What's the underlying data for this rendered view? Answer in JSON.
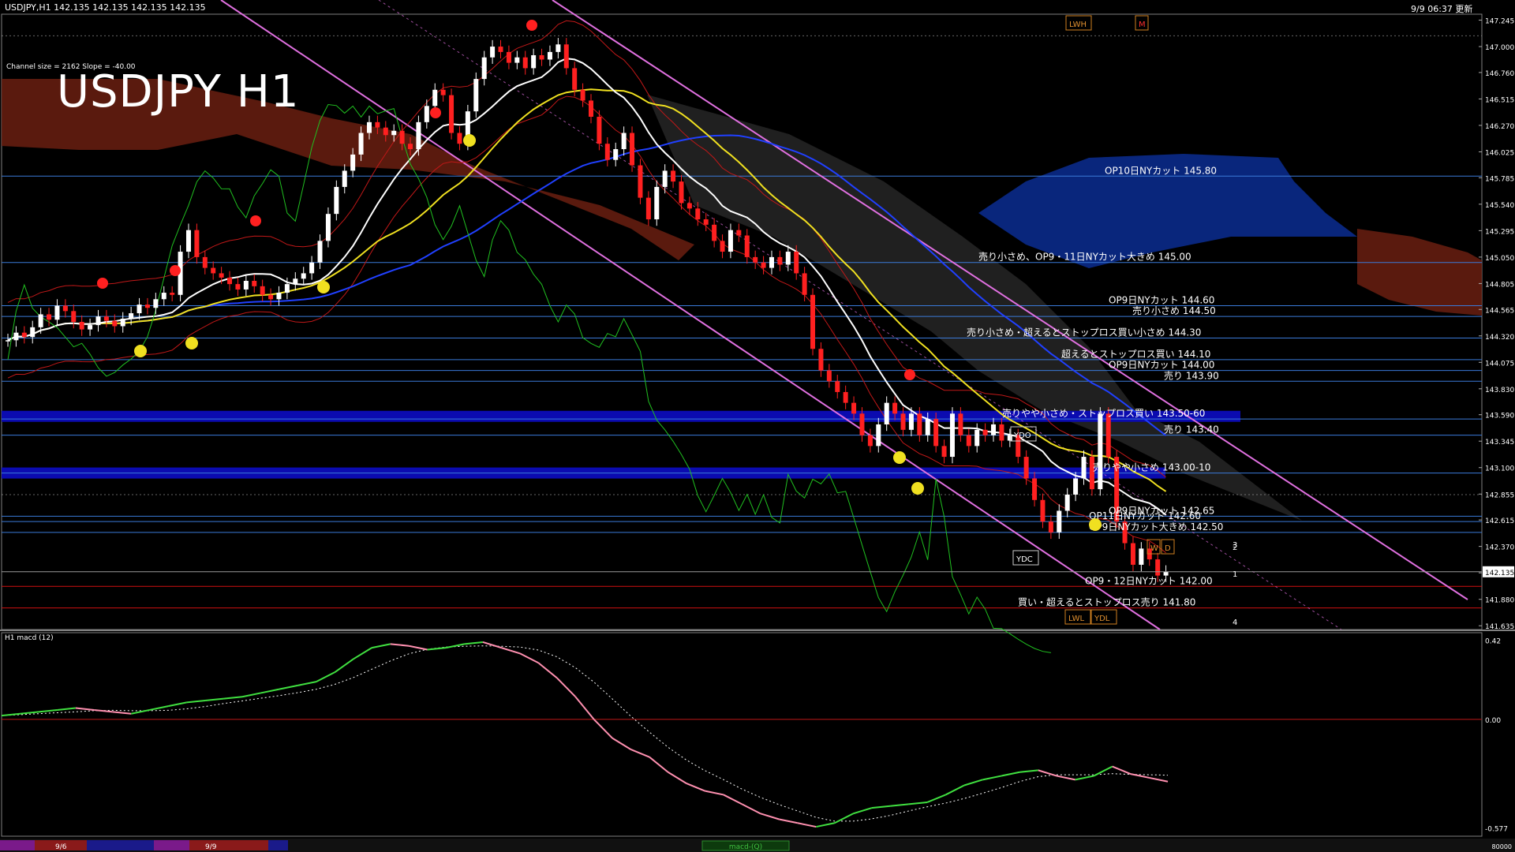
{
  "header": {
    "symbol_info": "USDJPY,H1  142.135 142.135 142.135 142.135",
    "datetime": "9/9 06:37 更新",
    "channel_info": "Channel size = 2162 Slope = -40.00",
    "big_title": "USDJPY H1"
  },
  "price_axis": {
    "labels": [
      "147.245",
      "147.000",
      "146.760",
      "146.515",
      "146.270",
      "146.025",
      "145.785",
      "145.540",
      "145.295",
      "145.050",
      "144.805",
      "144.565",
      "144.320",
      "144.075",
      "143.830",
      "143.590",
      "143.345",
      "143.100",
      "142.855",
      "142.615",
      "142.370",
      "142.125",
      "141.880",
      "141.635"
    ],
    "current_price": "142.135"
  },
  "macd_panel": {
    "title": "H1  macd (12)",
    "labels": [
      "0.42",
      "0.00",
      "-0.577"
    ]
  },
  "bottom_bar": {
    "dates": [
      "9/6",
      "9/9"
    ],
    "indicator_label": "macd-(Q)",
    "right_value": "80000"
  },
  "levels": [
    {
      "text": "OP10日NYカット 145.80",
      "color": "#ffffff"
    },
    {
      "text": "売り小さめ、OP9・11日NYカット大きめ 145.00",
      "color": "#ffffff"
    },
    {
      "text": "OP9日NYカット 144.60",
      "color": "#ffffff"
    },
    {
      "text": "売り小さめ 144.50",
      "color": "#ffffff"
    },
    {
      "text": "売り小さめ・超えるとストップロス買い小さめ 144.30",
      "color": "#ffffff"
    },
    {
      "text": "超えるとストップロス買い 144.10",
      "color": "#ffffff"
    },
    {
      "text": "OP9日NYカット 144.00",
      "color": "#ffffff"
    },
    {
      "text": "売り 143.90",
      "color": "#ffffff"
    },
    {
      "text": "売りやや小さめ・ストップロス買い 143.50-60",
      "color": "#ffffff"
    },
    {
      "text": "売り 143.40",
      "color": "#ffffff"
    },
    {
      "text": "売りやや小さめ 143.00-10",
      "color": "#ffffff"
    },
    {
      "text": "OP9日NYカット 142.65",
      "color": "#ffffff"
    },
    {
      "text": "OP11日NYカット 142.60",
      "color": "#ffffff"
    },
    {
      "text": "OP9日NYカット大きめ 142.50",
      "color": "#ffffff"
    },
    {
      "text": "OP9・12日NYカット 142.00",
      "color": "#ffffff"
    },
    {
      "text": "買い・超えるとストップロス売り 141.80",
      "color": "#ffffff"
    }
  ],
  "chart_markers": [
    "YDO",
    "YDC",
    "LWH",
    "M",
    "LWL",
    "YDL",
    "W",
    "D",
    "1",
    "2",
    "3",
    "4"
  ],
  "chart_data": {
    "type": "candlestick",
    "title": "USDJPY H1",
    "ylim": [
      141.6,
      147.3
    ],
    "close_series": [
      144.28,
      144.35,
      144.31,
      144.4,
      144.52,
      144.47,
      144.6,
      144.55,
      144.45,
      144.38,
      144.42,
      144.5,
      144.46,
      144.41,
      144.48,
      144.53,
      144.61,
      144.58,
      144.66,
      144.72,
      144.7,
      145.1,
      145.3,
      145.05,
      144.95,
      144.9,
      144.86,
      144.8,
      144.75,
      144.83,
      144.78,
      144.7,
      144.66,
      144.72,
      144.8,
      144.85,
      144.9,
      145.0,
      145.2,
      145.45,
      145.7,
      145.85,
      146.0,
      146.2,
      146.3,
      146.25,
      146.18,
      146.22,
      146.1,
      146.05,
      146.3,
      146.45,
      146.6,
      146.55,
      146.2,
      146.1,
      146.4,
      146.7,
      146.9,
      147.0,
      146.95,
      146.85,
      146.9,
      146.8,
      146.92,
      146.88,
      146.95,
      147.02,
      146.8,
      146.6,
      146.5,
      146.35,
      146.1,
      145.95,
      146.05,
      146.2,
      145.9,
      145.6,
      145.4,
      145.7,
      145.85,
      145.75,
      145.55,
      145.5,
      145.4,
      145.35,
      145.2,
      145.1,
      145.3,
      145.25,
      145.05,
      145.0,
      144.95,
      145.05,
      144.98,
      145.1,
      144.9,
      144.7,
      144.2,
      144.0,
      143.9,
      143.8,
      143.7,
      143.6,
      143.4,
      143.3,
      143.5,
      143.7,
      143.6,
      143.45,
      143.6,
      143.4,
      143.55,
      143.3,
      143.2,
      143.6,
      143.4,
      143.3,
      143.45,
      143.4,
      143.5,
      143.35,
      143.4,
      143.2,
      143.0,
      142.8,
      142.6,
      142.5,
      142.7,
      142.85,
      143.0,
      143.2,
      142.9,
      143.6,
      143.2,
      142.6,
      142.4,
      142.2,
      142.35,
      142.25,
      142.1,
      142.135
    ],
    "macd_series": [
      0.02,
      0.03,
      0.04,
      0.05,
      0.06,
      0.05,
      0.04,
      0.03,
      0.05,
      0.07,
      0.09,
      0.1,
      0.11,
      0.12,
      0.14,
      0.16,
      0.18,
      0.2,
      0.25,
      0.32,
      0.38,
      0.4,
      0.39,
      0.37,
      0.38,
      0.4,
      0.41,
      0.38,
      0.35,
      0.3,
      0.22,
      0.12,
      0.0,
      -0.1,
      -0.16,
      -0.2,
      -0.28,
      -0.34,
      -0.38,
      -0.4,
      -0.45,
      -0.5,
      -0.53,
      -0.55,
      -0.57,
      -0.55,
      -0.5,
      -0.47,
      -0.46,
      -0.45,
      -0.44,
      -0.4,
      -0.35,
      -0.32,
      -0.3,
      -0.28,
      -0.27,
      -0.3,
      -0.32,
      -0.3,
      -0.25,
      -0.29,
      -0.31,
      -0.33
    ],
    "overlays": [
      "Ichimoku cloud",
      "moving averages",
      "Bollinger bands",
      "regression channel"
    ]
  }
}
